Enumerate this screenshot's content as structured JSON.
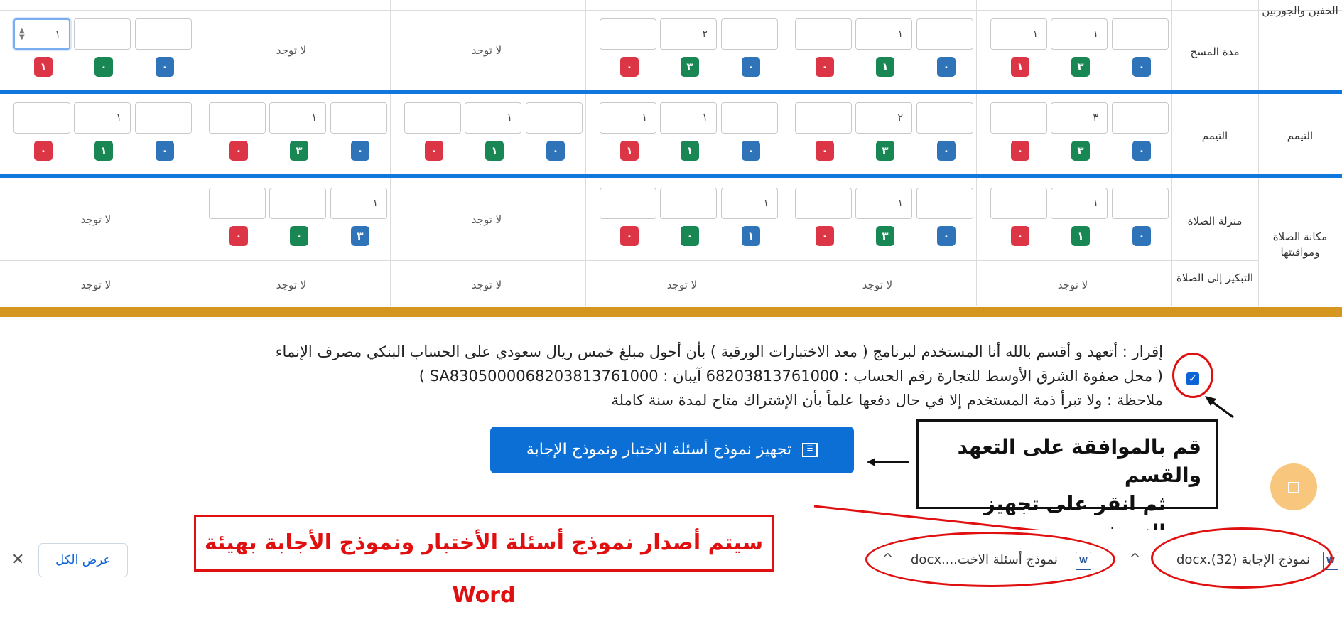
{
  "table": {
    "rows": [
      {
        "category": "الخفين والجوربين",
        "subcategory": "مدة المسح",
        "cells": [
          {
            "inputs": [
              "",
              "١",
              "١"
            ],
            "badges": [
              "٠",
              "٣",
              "١"
            ]
          },
          {
            "inputs": [
              "",
              "١",
              ""
            ],
            "badges": [
              "٠",
              "١",
              "٠"
            ]
          },
          {
            "inputs": [
              "",
              "٢",
              ""
            ],
            "badges": [
              "٠",
              "٣",
              "٠"
            ]
          },
          {
            "none_text": "لا توجد"
          },
          {
            "none_text": "لا توجد"
          },
          {
            "inputs": [
              "",
              "",
              "١"
            ],
            "badges": [
              "٠",
              "٠",
              "١"
            ]
          }
        ]
      },
      {
        "category": "التيمم",
        "subcategory": "التيمم",
        "cells": [
          {
            "inputs": [
              "",
              "٣",
              ""
            ],
            "badges": [
              "٠",
              "٣",
              "٠"
            ]
          },
          {
            "inputs": [
              "",
              "٢",
              ""
            ],
            "badges": [
              "٠",
              "٣",
              "٠"
            ]
          },
          {
            "inputs": [
              "",
              "١",
              "١"
            ],
            "badges": [
              "٠",
              "١",
              "١"
            ]
          },
          {
            "inputs": [
              "",
              "١",
              ""
            ],
            "badges": [
              "٠",
              "١",
              "٠"
            ]
          },
          {
            "inputs": [
              "",
              "١",
              ""
            ],
            "badges": [
              "٠",
              "٣",
              "٠"
            ]
          },
          {
            "inputs": [
              "",
              "١",
              ""
            ],
            "badges": [
              "٠",
              "١",
              "٠"
            ]
          }
        ]
      },
      {
        "category": "مكانة الصلاة ومواقيتها",
        "subcategory": "منزلة الصلاة",
        "cells": [
          {
            "inputs": [
              "",
              "١",
              ""
            ],
            "badges": [
              "٠",
              "١",
              "٠"
            ]
          },
          {
            "inputs": [
              "",
              "١",
              ""
            ],
            "badges": [
              "٠",
              "٣",
              "٠"
            ]
          },
          {
            "inputs": [
              "١",
              "",
              ""
            ],
            "badges": [
              "١",
              "٠",
              "٠"
            ]
          },
          {
            "none_text": "لا توجد"
          },
          {
            "inputs": [
              "١",
              "",
              ""
            ],
            "badges": [
              "٣",
              "٠",
              "٠"
            ]
          },
          {
            "none_text": "لا توجد"
          }
        ]
      },
      {
        "category": "",
        "subcategory": "التبكير إلى الصلاة",
        "cells": [
          {
            "none_text": "لا توجد"
          },
          {
            "none_text": "لا توجد"
          },
          {
            "none_text": "لا توجد"
          },
          {
            "none_text": "لا توجد"
          },
          {
            "none_text": "لا توجد"
          },
          {
            "none_text": "لا توجد"
          }
        ]
      }
    ]
  },
  "declaration": {
    "line1": "إقرار : أتعهد و أقسم بالله أنا المستخدم لبرنامج ( معد الاختبارات الورقية ) بأن أحول مبلغ خمس ريال سعودي على الحساب البنكي مصرف الإنماء",
    "line2": "( محل صفوة الشرق الأوسط للتجارة رقم الحساب : 68203813761000 آيبان : SA8305000068203813761000 )",
    "line3": "ملاحظة : ولا تبرأ ذمة المستخدم إلا في حال دفعها علماً بأن الإشتراك متاح لمدة سنة كاملة",
    "checked": true
  },
  "prepare_button": {
    "label": "تجهيز نموذج أسئلة الاختبار ونموذج الإجابة",
    "icon": "list-icon"
  },
  "annotation": {
    "line1": "قم بالموافقة على التعهد والقسم",
    "line2": "ثم انقر على تجهيز النموذج"
  },
  "banner": {
    "text": "سيتم أصدار نموذج أسئلة الأختبار ونموذج الأجابة بهيئة Word"
  },
  "downloads": {
    "items": [
      {
        "name": "نموذج الإجابة (32).docx",
        "icon": "word-file-icon"
      },
      {
        "name": "نموذج أسئلة الاخت....docx",
        "icon": "word-file-icon"
      }
    ],
    "show_all": "عرض الكل",
    "close": "✕"
  },
  "colors": {
    "accent_blue": "#1177dd",
    "badge_blue": "#2f73b8",
    "badge_green": "#198754",
    "badge_red": "#dc3545",
    "gold": "#d4961f",
    "annotation_red": "#e01010"
  }
}
